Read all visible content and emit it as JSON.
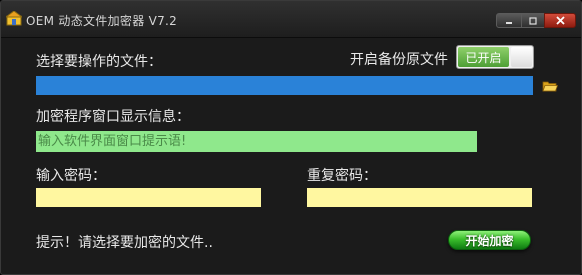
{
  "window": {
    "title": "OEM 动态文件加密器 V7.2"
  },
  "file_section": {
    "label": "选择要操作的文件：",
    "value": "",
    "browse_icon": "folder-open-icon",
    "backup_label": "开启备份原文件",
    "backup_toggle": {
      "state_label": "已开启",
      "on": true
    }
  },
  "message_section": {
    "label": "加密程序窗口显示信息：",
    "placeholder": "输入软件界面窗口提示语!"
  },
  "password_section": {
    "password_label": "输入密码：",
    "confirm_label": "重复密码：",
    "password_value": "",
    "confirm_value": ""
  },
  "footer": {
    "status_text": "提示！请选择要加密的文件..",
    "start_button_label": "开始加密"
  },
  "colors": {
    "file_field": "#2a82d8",
    "message_field": "#8fe88c",
    "password_fields": "#fff7a0",
    "start_button": "#3bbf2c",
    "toggle_on": "#5cb03c"
  }
}
